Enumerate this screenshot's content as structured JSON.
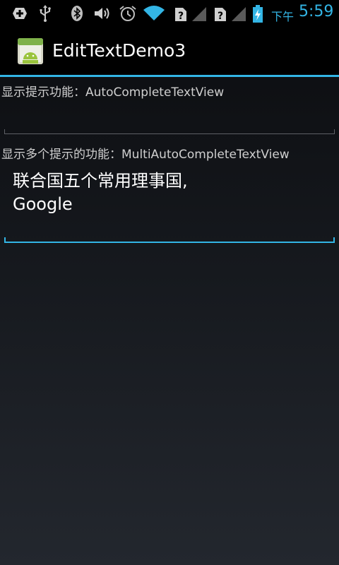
{
  "status_bar": {
    "icons": [
      "add-notification-icon",
      "usb-icon",
      "bluetooth-icon",
      "volume-icon",
      "alarm-icon",
      "wifi-icon",
      "sim-unknown-icon",
      "signal-icon",
      "sim-unknown-icon",
      "signal-icon",
      "battery-charging-icon"
    ],
    "ampm": "下午",
    "time": "5:59",
    "accent_color": "#33b5e5"
  },
  "action_bar": {
    "title": "EditTextDemo3",
    "icon": "android-app-icon"
  },
  "main": {
    "auto_complete": {
      "label": "显示提示功能：AutoCompleteTextView",
      "value": ""
    },
    "multi_auto_complete": {
      "label": "显示多个提示的功能：MultiAutoCompleteTextView",
      "lines": [
        "联合国五个常用理事国,",
        "Google"
      ]
    }
  },
  "colors": {
    "accent": "#33b5e5",
    "underline": "#5e6066"
  }
}
